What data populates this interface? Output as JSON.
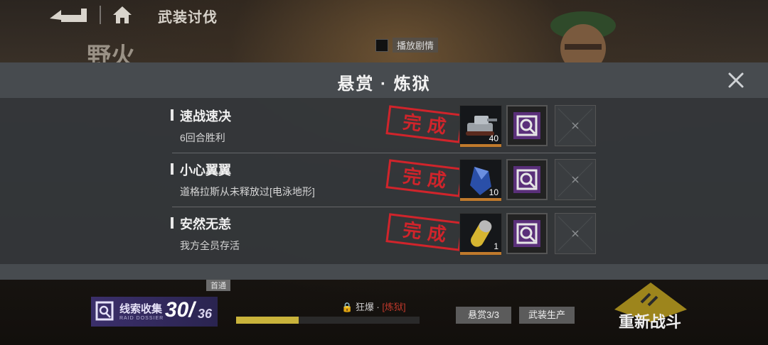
{
  "header": {
    "title": "武装讨伐",
    "stage_name": "野火",
    "story_toggle_label": "播放剧情"
  },
  "modal": {
    "title": "悬赏 · 炼狱",
    "stamp_text": "完 成",
    "tasks": [
      {
        "name": "速战速决",
        "desc": "6回合胜利",
        "reward_qty": "40",
        "reward_icon": "tank-icon"
      },
      {
        "name": "小心翼翼",
        "desc": "道格拉斯从未释放过[电泳地形]",
        "reward_qty": "10",
        "reward_icon": "crystal-icon"
      },
      {
        "name": "安然无恙",
        "desc": "我方全员存活",
        "reward_qty": "1",
        "reward_icon": "capsule-icon"
      }
    ]
  },
  "footer": {
    "clue_label": "线索收集",
    "clue_sub": "RAID DOSSIER",
    "clue_count": "30/",
    "clue_total": "36",
    "difficulty_prefix": "狂爆 ·",
    "difficulty_value": "[炼狱]",
    "progress": 0.34,
    "first_tag": "首通",
    "bounty_button": "悬赏3/3",
    "craft_button": "武装生产",
    "restart_button": "重新战斗"
  },
  "colors": {
    "stamp": "#d0242b",
    "clue_panel": "#3b2f6a",
    "progress_fill": "#c9b33b",
    "quality_bar": "#c07a2c"
  }
}
